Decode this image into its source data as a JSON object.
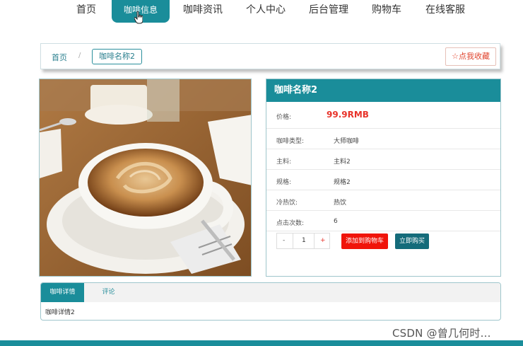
{
  "nav": {
    "items": [
      {
        "label": "首页"
      },
      {
        "label": "咖啡信息"
      },
      {
        "label": "咖啡资讯"
      },
      {
        "label": "个人中心"
      },
      {
        "label": "后台管理"
      },
      {
        "label": "购物车"
      },
      {
        "label": "在线客服"
      }
    ],
    "active_index": 1
  },
  "breadcrumb": {
    "home": "首页",
    "separator": "/",
    "current": "咖啡名称2",
    "favorite_label": "☆点我收藏"
  },
  "product": {
    "title": "咖啡名称2",
    "price_label": "价格:",
    "price_value": "99.9RMB",
    "rows": [
      {
        "label": "咖啡类型:",
        "value": "大师咖啡"
      },
      {
        "label": "主料:",
        "value": "主料2"
      },
      {
        "label": "规格:",
        "value": "规格2"
      },
      {
        "label": "冷热饮:",
        "value": "热饮"
      },
      {
        "label": "点击次数:",
        "value": "6"
      }
    ],
    "quantity": {
      "minus": "-",
      "value": "1",
      "plus": "+"
    },
    "add_to_cart_label": "添加到购物车",
    "buy_now_label": "立即购买"
  },
  "tabs": {
    "items": [
      {
        "label": "咖啡详情"
      },
      {
        "label": "评论"
      }
    ],
    "content": "咖啡详情2"
  },
  "watermark": "CSDN @曾几何时…",
  "colors": {
    "primary": "#1a8d9a",
    "price": "#e8332a",
    "cart_button": "#f0140a",
    "buy_button": "#146b7a"
  }
}
